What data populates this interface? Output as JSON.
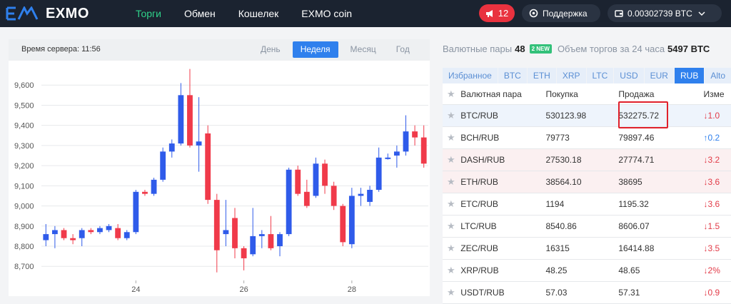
{
  "header": {
    "logo_text": "EXMO",
    "nav": [
      "Торги",
      "Обмен",
      "Кошелек",
      "EXMO coin"
    ],
    "notifications_count": "12",
    "support_label": "Поддержка",
    "balance": "0.00302739 BTC"
  },
  "chart": {
    "server_time": "Время сервера: 11:56",
    "periods": [
      "День",
      "Неделя",
      "Месяц",
      "Год"
    ],
    "active_period": "Неделя"
  },
  "market": {
    "pairs_label": "Валютные пары",
    "pairs_count": "48",
    "new_badge": "2 NEW",
    "volume_label": "Объем торгов за 24 часа",
    "volume_value": "5497 BTC",
    "tabs": [
      "Избранное",
      "BTC",
      "ETH",
      "XRP",
      "LTC",
      "USD",
      "EUR",
      "RUB",
      "Alto"
    ],
    "active_tab": "RUB",
    "columns": [
      "Валютная пара",
      "Покупка",
      "Продажа",
      "Изме"
    ],
    "rows": [
      {
        "pair": "BTC/RUB",
        "buy": "530123.98",
        "sell": "532275.72",
        "change": "↓1.0",
        "dir": "down",
        "hl": "blue"
      },
      {
        "pair": "BCH/RUB",
        "buy": "79773",
        "sell": "79897.46",
        "change": "↑0.2",
        "dir": "up",
        "hl": ""
      },
      {
        "pair": "DASH/RUB",
        "buy": "27530.18",
        "sell": "27774.71",
        "change": "↓3.2",
        "dir": "down",
        "hl": "red"
      },
      {
        "pair": "ETH/RUB",
        "buy": "38564.10",
        "sell": "38695",
        "change": "↓3.6",
        "dir": "down",
        "hl": "red"
      },
      {
        "pair": "ETC/RUB",
        "buy": "1194",
        "sell": "1195.32",
        "change": "↓3.6",
        "dir": "down",
        "hl": ""
      },
      {
        "pair": "LTC/RUB",
        "buy": "8540.86",
        "sell": "8606.07",
        "change": "↓1.5",
        "dir": "down",
        "hl": ""
      },
      {
        "pair": "ZEC/RUB",
        "buy": "16315",
        "sell": "16414.88",
        "change": "↓3.5",
        "dir": "down",
        "hl": ""
      },
      {
        "pair": "XRP/RUB",
        "buy": "48.25",
        "sell": "48.65",
        "change": "↓2%",
        "dir": "down",
        "hl": ""
      },
      {
        "pair": "USDT/RUB",
        "buy": "57.03",
        "sell": "57.31",
        "change": "↓0.9",
        "dir": "down",
        "hl": ""
      }
    ]
  },
  "colors": {
    "up": "#2f5bea",
    "down": "#f03a4a",
    "accent": "#2f80ed",
    "nav_active": "#2fd28a"
  },
  "chart_data": {
    "type": "candlestick",
    "y_ticks": [
      9600,
      9500,
      9400,
      9300,
      9200,
      9100,
      9000,
      8900,
      8800,
      8700
    ],
    "y_tick_labels": [
      "9,600",
      "9,500",
      "9,400",
      "9,300",
      "9,200",
      "9,100",
      "9,000",
      "8,900",
      "8,800",
      "8,700"
    ],
    "ylim": [
      8630,
      9700
    ],
    "x_ticks": [
      {
        "i": 10,
        "label": "24"
      },
      {
        "i": 22,
        "label": "26"
      },
      {
        "i": 34,
        "label": "28"
      }
    ],
    "candles": [
      {
        "o": 8830,
        "c": 8860,
        "h": 8910,
        "l": 8800
      },
      {
        "o": 8860,
        "c": 8880,
        "h": 8900,
        "l": 8790
      },
      {
        "o": 8880,
        "c": 8840,
        "h": 8890,
        "l": 8830
      },
      {
        "o": 8840,
        "c": 8830,
        "h": 8860,
        "l": 8810
      },
      {
        "o": 8840,
        "c": 8880,
        "h": 8890,
        "l": 8800
      },
      {
        "o": 8880,
        "c": 8870,
        "h": 8890,
        "l": 8860
      },
      {
        "o": 8870,
        "c": 8890,
        "h": 8900,
        "l": 8860
      },
      {
        "o": 8880,
        "c": 8900,
        "h": 8910,
        "l": 8870
      },
      {
        "o": 8890,
        "c": 8840,
        "h": 8910,
        "l": 8830
      },
      {
        "o": 8840,
        "c": 8870,
        "h": 8880,
        "l": 8830
      },
      {
        "o": 8870,
        "c": 9070,
        "h": 9080,
        "l": 8860
      },
      {
        "o": 9070,
        "c": 9060,
        "h": 9080,
        "l": 9050
      },
      {
        "o": 9060,
        "c": 9130,
        "h": 9140,
        "l": 9050
      },
      {
        "o": 9130,
        "c": 9270,
        "h": 9290,
        "l": 9120
      },
      {
        "o": 9270,
        "c": 9310,
        "h": 9330,
        "l": 9240
      },
      {
        "o": 9310,
        "c": 9550,
        "h": 9610,
        "l": 9300
      },
      {
        "o": 9550,
        "c": 9300,
        "h": 9680,
        "l": 9290
      },
      {
        "o": 9300,
        "c": 9320,
        "h": 9540,
        "l": 9170
      },
      {
        "o": 9360,
        "c": 9030,
        "h": 9400,
        "l": 9010
      },
      {
        "o": 9030,
        "c": 8780,
        "h": 9060,
        "l": 8670
      },
      {
        "o": 8860,
        "c": 8880,
        "h": 9030,
        "l": 8800
      },
      {
        "o": 8940,
        "c": 8790,
        "h": 8990,
        "l": 8740
      },
      {
        "o": 8790,
        "c": 8740,
        "h": 8800,
        "l": 8680
      },
      {
        "o": 8760,
        "c": 8850,
        "h": 8990,
        "l": 8750
      },
      {
        "o": 8850,
        "c": 8860,
        "h": 8880,
        "l": 8790
      },
      {
        "o": 8860,
        "c": 8790,
        "h": 8950,
        "l": 8780
      },
      {
        "o": 8800,
        "c": 8860,
        "h": 8870,
        "l": 8750
      },
      {
        "o": 8860,
        "c": 9180,
        "h": 9190,
        "l": 8850
      },
      {
        "o": 9180,
        "c": 9060,
        "h": 9200,
        "l": 9050
      },
      {
        "o": 9070,
        "c": 9000,
        "h": 9130,
        "l": 8990
      },
      {
        "o": 9050,
        "c": 9210,
        "h": 9240,
        "l": 9040
      },
      {
        "o": 9210,
        "c": 9100,
        "h": 9230,
        "l": 9060
      },
      {
        "o": 9100,
        "c": 9000,
        "h": 9120,
        "l": 8980
      },
      {
        "o": 9000,
        "c": 8820,
        "h": 9010,
        "l": 8800
      },
      {
        "o": 8810,
        "c": 9050,
        "h": 9090,
        "l": 8790
      },
      {
        "o": 9050,
        "c": 9060,
        "h": 9090,
        "l": 9000
      },
      {
        "o": 9020,
        "c": 9080,
        "h": 9100,
        "l": 9000
      },
      {
        "o": 9080,
        "c": 9240,
        "h": 9290,
        "l": 9070
      },
      {
        "o": 9240,
        "c": 9240,
        "h": 9260,
        "l": 9230
      },
      {
        "o": 9250,
        "c": 9270,
        "h": 9300,
        "l": 9190
      },
      {
        "o": 9270,
        "c": 9370,
        "h": 9450,
        "l": 9250
      },
      {
        "o": 9370,
        "c": 9340,
        "h": 9400,
        "l": 9300
      },
      {
        "o": 9340,
        "c": 9210,
        "h": 9400,
        "l": 9190
      }
    ]
  }
}
